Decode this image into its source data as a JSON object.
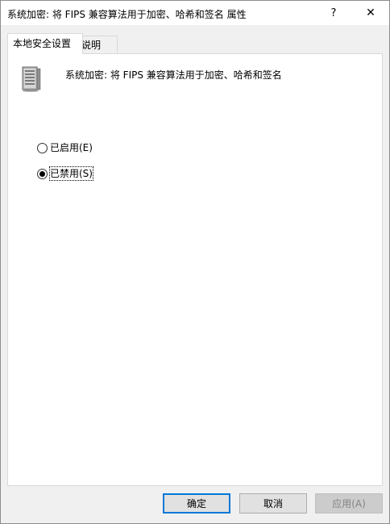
{
  "window": {
    "title": "系统加密: 将 FIPS 兼容算法用于加密、哈希和签名 属性",
    "help_glyph": "?",
    "close_glyph": "✕"
  },
  "tabs": [
    {
      "label": "本地安全设置",
      "active": true
    },
    {
      "label": "说明",
      "active": false
    }
  ],
  "policy": {
    "title": "系统加密: 将 FIPS 兼容算法用于加密、哈希和签名",
    "icon": "server-computer-icon"
  },
  "options": [
    {
      "label": "已启用(E)",
      "checked": false
    },
    {
      "label": "已禁用(S)",
      "checked": true
    }
  ],
  "buttons": {
    "ok": "确定",
    "cancel": "取消",
    "apply": "应用(A)"
  }
}
